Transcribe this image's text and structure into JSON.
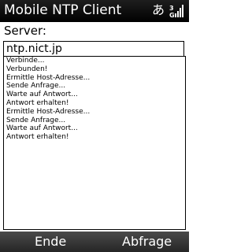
{
  "title_bar": {
    "title": "Mobile NTP Client",
    "input_mode": "あ",
    "signal_icon": "signal-strength-icon"
  },
  "form": {
    "server_label": "Server:",
    "server_value": "ntp.nict.jp"
  },
  "log": {
    "lines": [
      "Verbinde...",
      "Verbunden!",
      "Ermittle Host-Adresse...",
      "Sende Anfrage...",
      "Warte auf Antwort...",
      "Antwort erhalten!",
      "Ermittle Host-Adresse...",
      "Sende Anfrage...",
      "Warte auf Antwort...",
      "Antwort erhalten!"
    ]
  },
  "softkeys": {
    "left": "Ende",
    "right": "Abfrage"
  },
  "colors": {
    "title_bar_bg": "#000000",
    "softkey_bar_bg": "#333333",
    "text": "#000000",
    "background": "#ffffff"
  }
}
